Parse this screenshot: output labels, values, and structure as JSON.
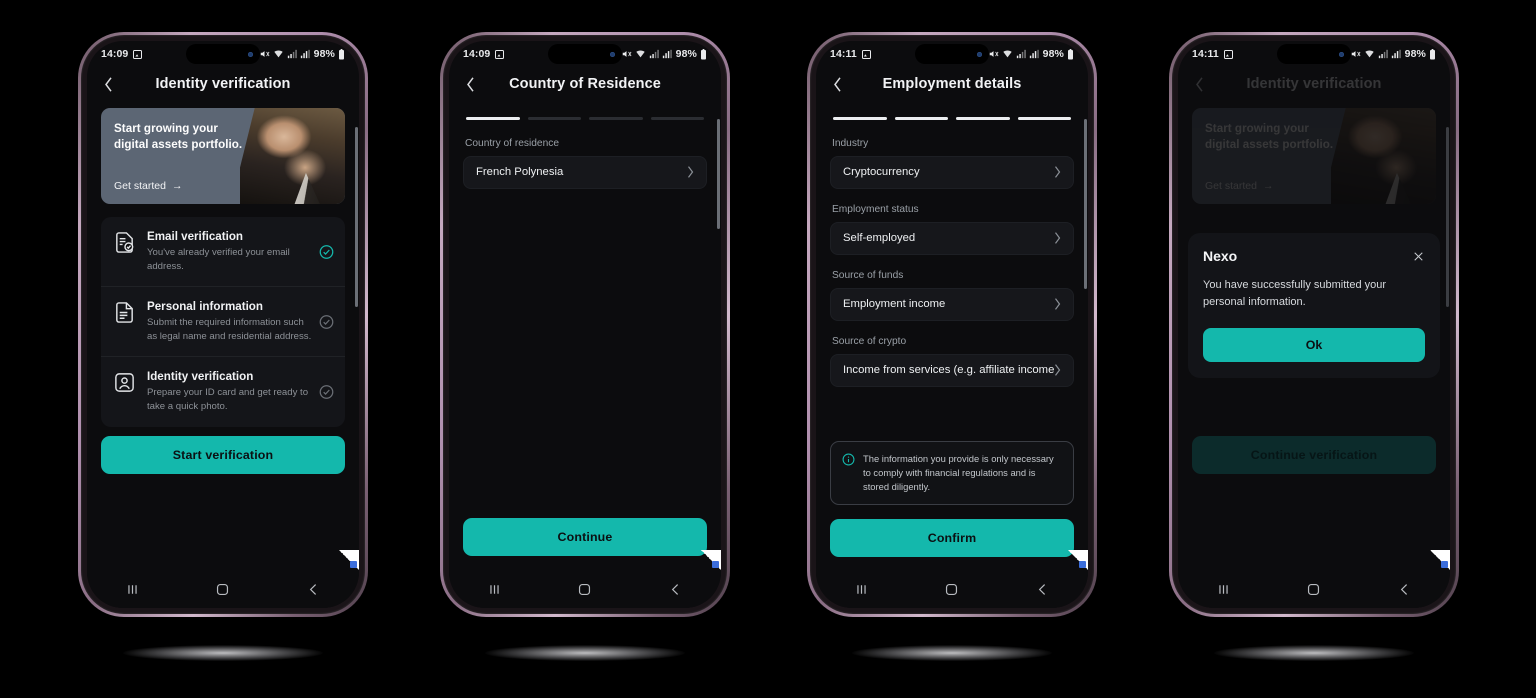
{
  "colors": {
    "accent_teal": "#14b8ac",
    "screen_bg": "#0c0c0e",
    "card_bg": "#141519",
    "banner_bg": "#5c6674",
    "bezel_rose": "#b08fae"
  },
  "status_bar": {
    "time_1409": "14:09",
    "time_1411": "14:11",
    "battery": "98%",
    "icons": [
      "screenshot-icon",
      "cast-icon",
      "bluetooth-icon",
      "mute-icon",
      "wifi-icon",
      "signal-icon",
      "signal-2-icon",
      "battery-icon"
    ]
  },
  "nav_bar": {
    "recents": "recents-icon",
    "home": "home-icon",
    "back": "back-icon"
  },
  "phone1": {
    "header_title": "Identity verification",
    "banner": {
      "line1": "Start growing your",
      "line2": "digital assets portfolio.",
      "cta": "Get started",
      "cta_arrow": "→"
    },
    "items": [
      {
        "title": "Email verification",
        "subtitle": "You've already verified your email address.",
        "icon": "document-check-icon",
        "status": "completed"
      },
      {
        "title": "Personal information",
        "subtitle": "Submit the required information such as legal name and residential address.",
        "icon": "document-icon",
        "status": "pending"
      },
      {
        "title": "Identity verification",
        "subtitle": "Prepare your ID card and get ready to take a quick photo.",
        "icon": "id-card-icon",
        "status": "pending"
      }
    ],
    "primary_button": "Start verification"
  },
  "phone2": {
    "header_title": "Country of Residence",
    "steps": [
      true,
      false,
      false,
      false
    ],
    "fields": [
      {
        "label": "Country of residence",
        "value": "French Polynesia"
      }
    ],
    "primary_button": "Continue"
  },
  "phone3": {
    "header_title": "Employment details",
    "steps": [
      true,
      true,
      true,
      true
    ],
    "fields": [
      {
        "label": "Industry",
        "value": "Cryptocurrency"
      },
      {
        "label": "Employment status",
        "value": "Self-employed"
      },
      {
        "label": "Source of funds",
        "value": "Employment income"
      },
      {
        "label": "Source of crypto",
        "value": "Income from services (e.g. affiliate income"
      }
    ],
    "info_note": "The information you provide is only necessary to comply with financial regulations and is stored diligently.",
    "primary_button": "Confirm"
  },
  "phone4": {
    "header_title": "Identity verification",
    "banner": {
      "line1": "Start growing your",
      "line2": "digital assets portfolio.",
      "cta": "Get started",
      "cta_arrow": "→"
    },
    "primary_button": "Continue verification",
    "modal": {
      "title": "Nexo",
      "body": "You have successfully submitted your personal information.",
      "ok_button": "Ok",
      "close_icon": "close-icon"
    }
  }
}
